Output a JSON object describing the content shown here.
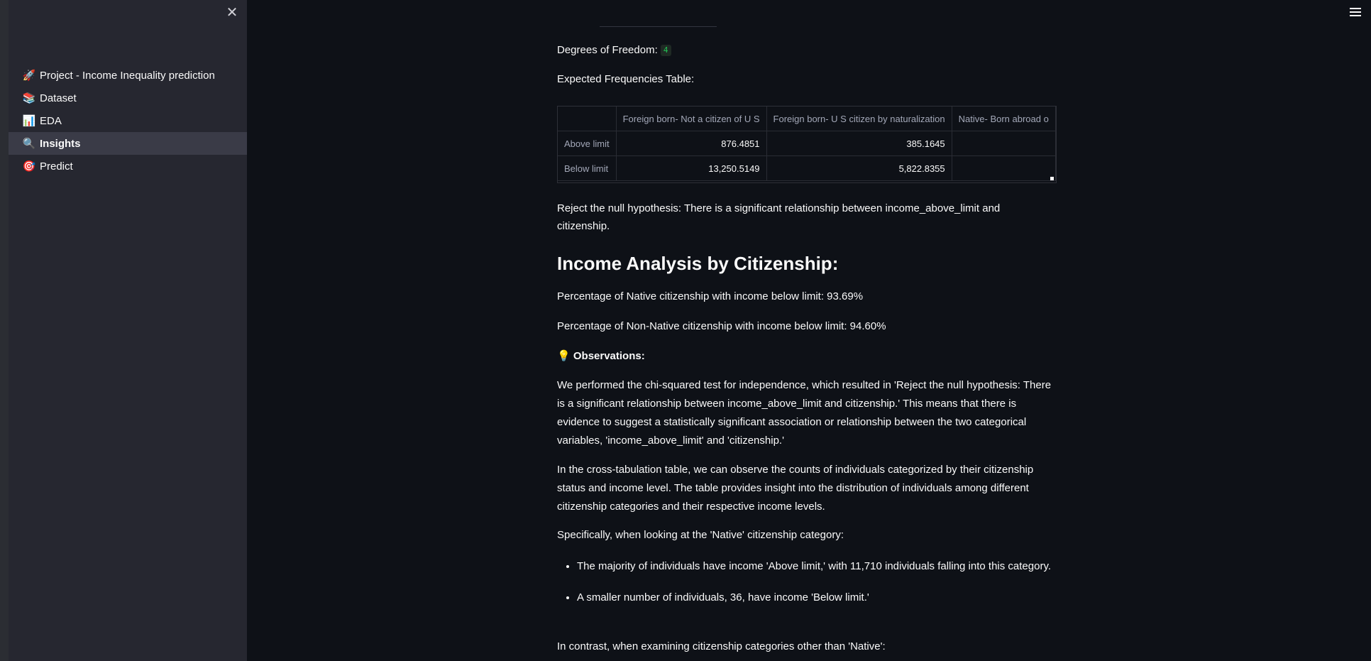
{
  "sidebar": {
    "items": [
      {
        "icon": "🚀",
        "icon_name": "rocket-icon",
        "label": "Project - Income Inequality prediction",
        "active": false
      },
      {
        "icon": "📚",
        "icon_name": "books-icon",
        "label": "Dataset",
        "active": false
      },
      {
        "icon": "📊",
        "icon_name": "bar-chart-icon",
        "label": "EDA",
        "active": false
      },
      {
        "icon": "🔍",
        "icon_name": "magnifier-icon",
        "label": "Insights",
        "active": true
      },
      {
        "icon": "🎯",
        "icon_name": "target-icon",
        "label": "Predict",
        "active": false
      }
    ]
  },
  "main": {
    "dof_label": "Degrees of Freedom:",
    "dof_value": "4",
    "expected_title": "Expected Frequencies Table:",
    "table": {
      "columns": [
        "",
        "Foreign born- Not a citizen of U S",
        "Foreign born- U S citizen by naturalization",
        "Native- Born abroad o"
      ],
      "rows": [
        {
          "label": "Above limit",
          "values": [
            "876.4851",
            "385.1645",
            ""
          ]
        },
        {
          "label": "Below limit",
          "values": [
            "13,250.5149",
            "5,822.8355",
            ""
          ]
        }
      ]
    },
    "reject_text": "Reject the null hypothesis: There is a significant relationship between income_above_limit and citizenship.",
    "heading": "Income Analysis by Citizenship:",
    "pct_native": "Percentage of Native citizenship with income below limit: 93.69%",
    "pct_non_native": "Percentage of Non-Native citizenship with income below limit: 94.60%",
    "observations_icon": "💡",
    "observations_label": "Observations:",
    "para1": "We performed the chi-squared test for independence, which resulted in 'Reject the null hypothesis: There is a significant relationship between income_above_limit and citizenship.' This means that there is evidence to suggest a statistically significant association or relationship between the two categorical variables, 'income_above_limit' and 'citizenship.'",
    "para2": "In the cross-tabulation table, we can observe the counts of individuals categorized by their citizenship status and income level. The table provides insight into the distribution of individuals among different citizenship categories and their respective income levels.",
    "para3": "Specifically, when looking at the 'Native' citizenship category:",
    "bullets": [
      "The majority of individuals have income 'Above limit,' with 11,710 individuals falling into this category.",
      "A smaller number of individuals, 36, have income 'Below limit.'"
    ],
    "para4": "In contrast, when examining citizenship categories other than 'Native':"
  },
  "colors": {
    "background": "#0e1117",
    "sidebar": "#262730",
    "active_item": "#3a3b47",
    "code_green": "#21c354"
  }
}
